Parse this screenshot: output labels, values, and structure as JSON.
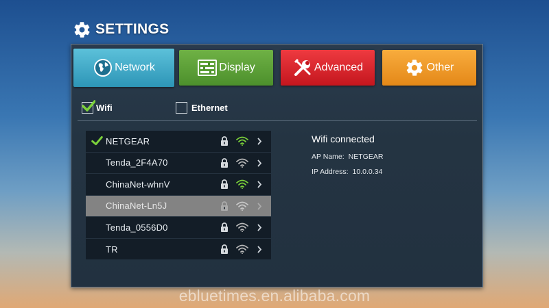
{
  "header": {
    "title": "SETTINGS",
    "icon": "gear-icon"
  },
  "tabs": [
    {
      "label": "Network",
      "icon": "globe-icon",
      "color": "#3aa6c4",
      "selected": true
    },
    {
      "label": "Display",
      "icon": "display-settings-icon",
      "color": "#5aa136"
    },
    {
      "label": "Advanced",
      "icon": "tools-icon",
      "color": "#d9242b"
    },
    {
      "label": "Other",
      "icon": "gear-icon",
      "color": "#f29a26"
    }
  ],
  "connection_types": [
    {
      "label": "Wifi",
      "checked": true
    },
    {
      "label": "Ethernet",
      "checked": false
    }
  ],
  "networks": [
    {
      "ssid": "NETGEAR",
      "connected": true,
      "locked": true,
      "signal_icon": "wifi-icon",
      "signal_color": "#7bd13a"
    },
    {
      "ssid": "Tenda_2F4A70",
      "connected": false,
      "locked": true,
      "signal_icon": "wifi-icon",
      "signal_color": "#b8b8b8"
    },
    {
      "ssid": "ChinaNet-whnV",
      "connected": false,
      "locked": true,
      "signal_icon": "wifi-icon",
      "signal_color": "#7bd13a"
    },
    {
      "ssid": "ChinaNet-Ln5J",
      "connected": false,
      "locked": true,
      "selected": true,
      "signal_icon": "wifi-icon",
      "signal_color": "#c8c8c8"
    },
    {
      "ssid": "Tenda_0556D0",
      "connected": false,
      "locked": true,
      "signal_icon": "wifi-icon",
      "signal_color": "#b8b8b8"
    },
    {
      "ssid": "TR",
      "connected": false,
      "locked": true,
      "signal_icon": "wifi-icon",
      "signal_color": "#b8b8b8"
    }
  ],
  "status": {
    "title": "Wifi connected",
    "ap_label": "AP Name:",
    "ap_value": "NETGEAR",
    "ip_label": "IP Address:",
    "ip_value": "10.0.0.34"
  },
  "watermark": "ebluetimes.en.alibaba.com"
}
